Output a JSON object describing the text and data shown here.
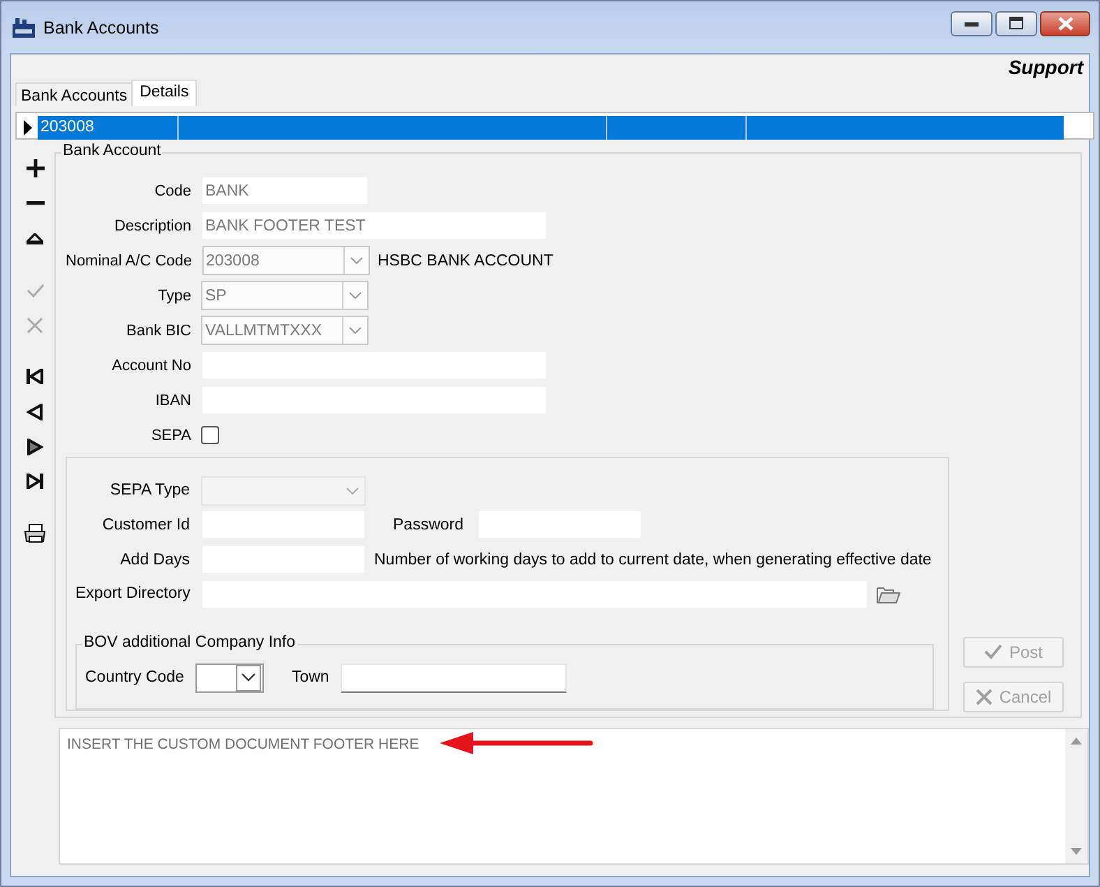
{
  "window": {
    "title": "Bank Accounts"
  },
  "header": {
    "user": "Support"
  },
  "tabs": [
    {
      "label": "Bank Accounts",
      "selected": false
    },
    {
      "label": "Details",
      "selected": true
    }
  ],
  "grid": {
    "rows": [
      {
        "cells": [
          "203008"
        ],
        "selected": true
      }
    ]
  },
  "toolbar": [
    {
      "kind": "add",
      "disabled": false
    },
    {
      "kind": "remove",
      "disabled": false
    },
    {
      "kind": "up",
      "disabled": false
    },
    {
      "kind": "confirm",
      "disabled": true
    },
    {
      "kind": "cancel",
      "disabled": true
    },
    {
      "kind": "first",
      "disabled": false
    },
    {
      "kind": "previous",
      "disabled": false
    },
    {
      "kind": "next",
      "disabled": false
    },
    {
      "kind": "last",
      "disabled": false
    },
    {
      "kind": "print",
      "disabled": false
    }
  ],
  "bank_account": {
    "title": "Bank Account",
    "fields": [
      {
        "label": "Code",
        "kind": "text",
        "value": "BANK"
      },
      {
        "label": "Description",
        "kind": "text",
        "value": "BANK FOOTER TEST"
      },
      {
        "label": "Nominal A/C Code",
        "kind": "combo",
        "value": "203008",
        "note": "HSBC BANK ACCOUNT"
      },
      {
        "label": "Type",
        "kind": "combo",
        "value": "SP"
      },
      {
        "label": "Bank BIC",
        "kind": "combo",
        "value": "VALLMTMTXXX"
      },
      {
        "label": "Account No",
        "kind": "text"
      },
      {
        "label": "IBAN",
        "kind": "text"
      },
      {
        "label": "SEPA",
        "kind": "checkbox",
        "checked": false
      }
    ],
    "sepa": {
      "sepa_type": {
        "label": "SEPA Type"
      },
      "customer_id": {
        "label": "Customer Id"
      },
      "password": {
        "label": "Password"
      },
      "add_days": {
        "label": "Add Days",
        "note": "Number of working days to add to current date, when generating effective date"
      },
      "export_directory": {
        "label": "Export Directory"
      }
    },
    "bov": {
      "title": "BOV additional Company Info",
      "country_code": {
        "label": "Country Code"
      },
      "town": {
        "label": "Town"
      }
    }
  },
  "buttons": [
    {
      "label": "Post",
      "kind": "post",
      "disabled": true
    },
    {
      "label": "Cancel",
      "kind": "cancel",
      "disabled": true
    }
  ],
  "footer": {
    "value": "INSERT THE CUSTOM DOCUMENT FOOTER HERE"
  }
}
